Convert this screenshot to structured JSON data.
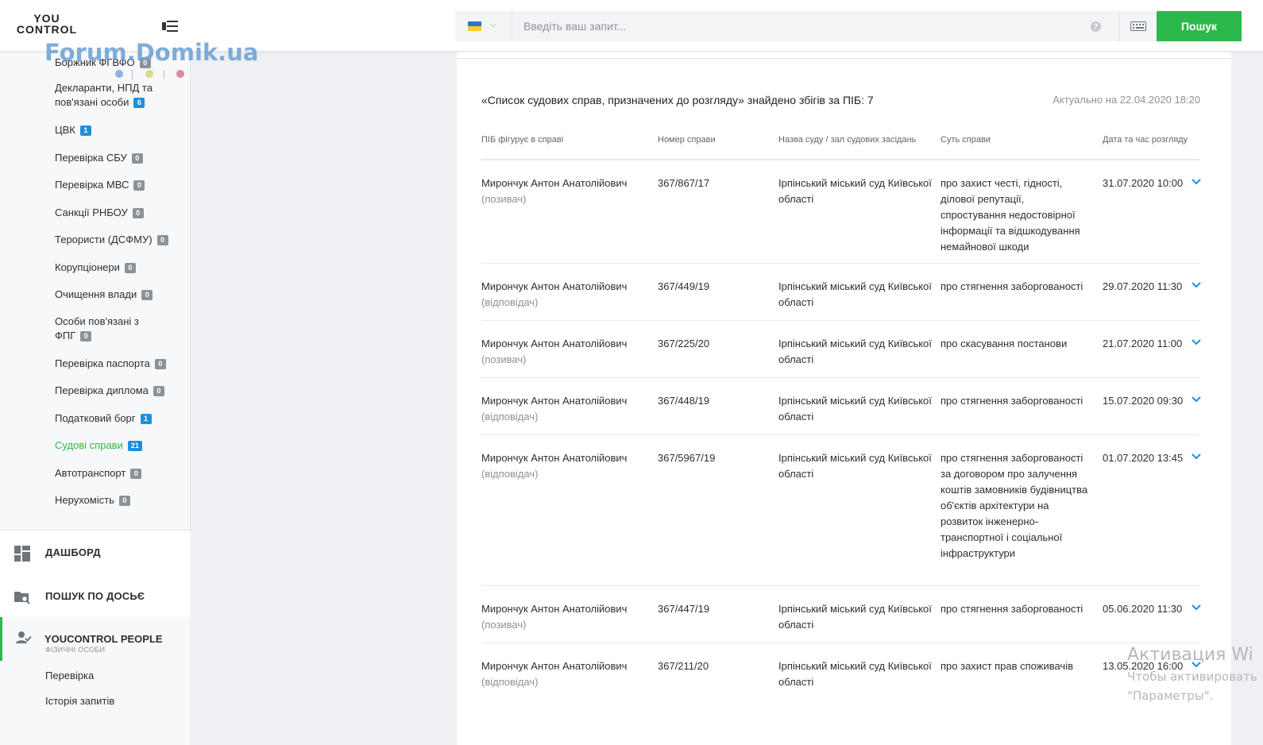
{
  "header": {
    "logo_line1": "YOU",
    "logo_line2": "CONTROL",
    "search_placeholder": "Введіть ваш запит...",
    "search_button": "Пошук"
  },
  "watermark": "Forum.Domik.ua",
  "sidebar": {
    "items": [
      {
        "label": "Боржник ФГВФО",
        "count": "0",
        "badge": "grey"
      },
      {
        "label": "Декларанти, НПД та пов'язані особи",
        "count": "6",
        "badge": "blue"
      },
      {
        "label": "ЦВК",
        "count": "1",
        "badge": "blue"
      },
      {
        "label": "Перевірка СБУ",
        "count": "0",
        "badge": "grey"
      },
      {
        "label": "Перевірка МВС",
        "count": "0",
        "badge": "grey"
      },
      {
        "label": "Санкції РНБОУ",
        "count": "0",
        "badge": "grey"
      },
      {
        "label": "Терористи (ДСФМУ)",
        "count": "0",
        "badge": "grey"
      },
      {
        "label": "Корупціонери",
        "count": "0",
        "badge": "grey"
      },
      {
        "label": "Очищення влади",
        "count": "0",
        "badge": "grey"
      },
      {
        "label": "Особи пов'язані з ФПГ",
        "count": "0",
        "badge": "grey"
      },
      {
        "label": "Перевірка паспорта",
        "count": "0",
        "badge": "grey"
      },
      {
        "label": "Перевірка диплома",
        "count": "0",
        "badge": "grey"
      },
      {
        "label": "Податковий борг",
        "count": "1",
        "badge": "blue"
      },
      {
        "label": "Судові справи",
        "count": "21",
        "badge": "blue",
        "active": true
      },
      {
        "label": "Автотранспорт",
        "count": "0",
        "badge": "grey"
      },
      {
        "label": "Нерухомість",
        "count": "0",
        "badge": "grey"
      }
    ],
    "nav": {
      "dashboard": "ДАШБОРД",
      "dossier": "ПОШУК ПО ДОСЬЄ",
      "people_title": "YOUCONTROL PEOPLE",
      "people_sub": "ФІЗИЧНІ ОСОБИ",
      "check": "Перевірка",
      "history": "Історія запитів"
    }
  },
  "results": {
    "title": "«Список судових справ, призначених до розгляду» знайдено збігів за ПІБ: 7",
    "updated": "Актуально на 22.04.2020 18:20",
    "columns": [
      "ПІБ фігурує в справі",
      "Номер справи",
      "Назва суду / зал судових засідань",
      "Суть справи",
      "Дата та час розгляду"
    ],
    "rows": [
      {
        "name": "Мирончук Антон Анатолійович",
        "role": "(позивач)",
        "number": "367/867/17",
        "court": "Ірпінський міський суд Київської області",
        "subject": "про захист честі, гідності, ділової репутації, спростування недостовірної інформації та відшкодування немайнової шкоди",
        "date": "31.07.2020 10:00"
      },
      {
        "name": "Мирончук Антон Анатолійович",
        "role": "(відповідач)",
        "number": "367/449/19",
        "court": "Ірпінський міський суд Київської області",
        "subject": "про стягнення заборгованості",
        "date": "29.07.2020 11:30"
      },
      {
        "name": "Мирончук Антон Анатолійович",
        "role": "(позивач)",
        "number": "367/225/20",
        "court": "Ірпінський міський суд Київської області",
        "subject": "про скасування постанови",
        "date": "21.07.2020 11:00"
      },
      {
        "name": "Мирончук Антон Анатолійович",
        "role": "(відповідач)",
        "number": "367/448/19",
        "court": "Ірпінський міський суд Київської області",
        "subject": "про стягнення заборгованості",
        "date": "15.07.2020 09:30"
      },
      {
        "name": "Мирончук Антон Анатолійович",
        "role": "(відповідач)",
        "number": "367/5967/19",
        "court": "Ірпінський міський суд Київської області",
        "subject": "про стягнення заборгованості за договором про залучення коштів замовників будівництва об'єктів архітектури на розвиток інженерно-транспортної і соціальної інфраструктури",
        "date": "01.07.2020 13:45"
      },
      {
        "name": "Мирончук Антон Анатолійович",
        "role": "(позивач)",
        "number": "367/447/19",
        "court": "Ірпінський міський суд Київської області",
        "subject": "про стягнення заборгованості",
        "date": "05.06.2020 11:30"
      },
      {
        "name": "Мирончук Антон Анатолійович",
        "role": "(відповідач)",
        "number": "367/211/20",
        "court": "Ірпінський міський суд Київської області",
        "subject": "про захист прав споживачів",
        "date": "13.05.2020 16:00"
      }
    ]
  },
  "windows_activation": {
    "line1": "Активация Wi",
    "line2": "Чтобы активировать",
    "line3": "\"Параметры\"."
  },
  "colors": {
    "accent_green": "#2db84c",
    "badge_blue": "#1f8fdc",
    "badge_grey": "#8d9298",
    "chevron_blue": "#1f8fdc"
  }
}
